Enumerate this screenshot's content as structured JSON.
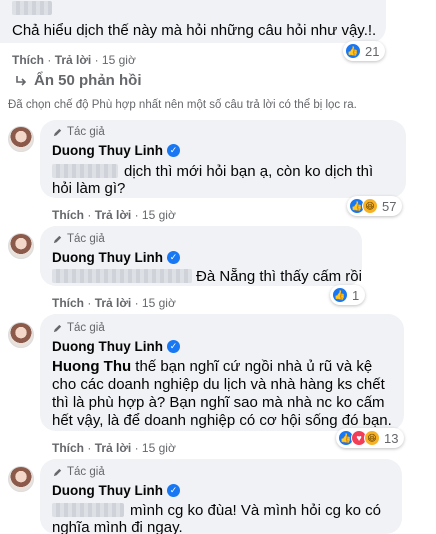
{
  "top_comment": {
    "text": "Chả hiểu dịch thế này mà hỏi những câu hỏi như vậy.!.",
    "reaction_count": "21",
    "actions": {
      "like": "Thích",
      "reply": "Trả lời",
      "time": "15 giờ"
    }
  },
  "hide_replies_label": "Ẩn 50 phản hồi",
  "filter_note": "Đã chọn chế độ Phù hợp nhất nên một số câu trả lời có thể bị lọc ra.",
  "author_tag": "Tác giả",
  "author_name": "Duong Thuy Linh",
  "actions": {
    "like": "Thích",
    "reply": "Trả lời",
    "time": "15 giờ"
  },
  "replies": [
    {
      "line1": "dịch thì mới hỏi bạn ạ, còn ko dịch thì",
      "line2": "hỏi làm gì?",
      "reaction_count": "57"
    },
    {
      "line1": "Đà Nẵng thì thấy cấm rồi",
      "reaction_count": "1"
    },
    {
      "mention": "Huong Thu",
      "line1": " thế bạn nghĩ cứ ngồi nhà ủ rũ và kệ",
      "line2": "cho các doanh nghiệp du lịch và nhà hàng ks chết",
      "line3": "thì là phù hợp à? Bạn nghĩ sao mà nhà nc ko cấm",
      "line4": "hết vậy, là để doanh nghiệp có cơ hội sống đó bạn.",
      "reaction_count": "13"
    },
    {
      "line1": "mình cg ko đùa! Và mình hỏi cg ko có",
      "line2": "nghĩa mình đi ngay."
    }
  ],
  "colors": {
    "bubble": "#f0f2f5",
    "meta": "#65676b",
    "accent": "#1877f2"
  }
}
